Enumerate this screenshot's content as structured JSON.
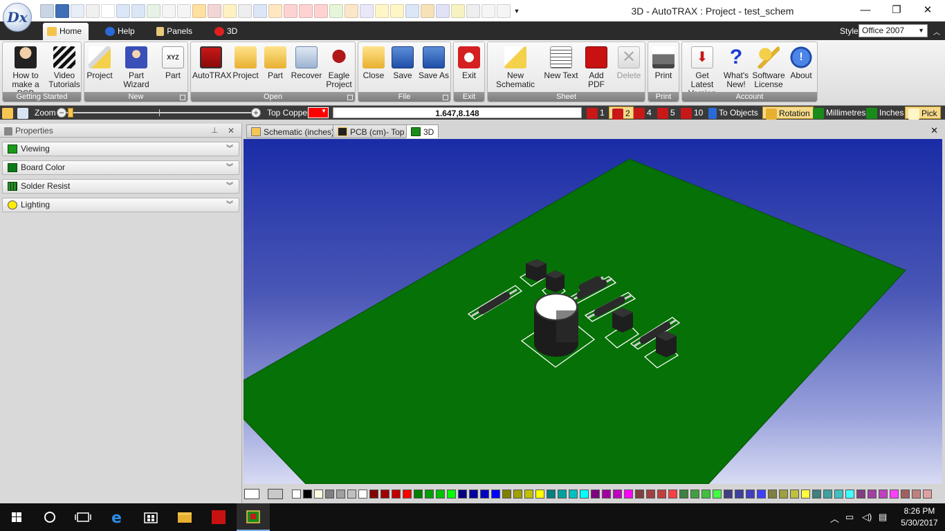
{
  "window": {
    "title": "3D - AutoTRAX : Project - test_schem",
    "logo_text": "Dx",
    "minimize": "—",
    "maximize": "❐",
    "close": "✕"
  },
  "menu_tabs": [
    {
      "label": "Home",
      "active": true
    },
    {
      "label": "Help"
    },
    {
      "label": "Panels"
    },
    {
      "label": "3D"
    }
  ],
  "style": {
    "label": "Style",
    "value": "Office 2007"
  },
  "ribbon": {
    "groups": [
      {
        "label": "Getting Started",
        "buttons": [
          {
            "label": "How to make a PCB"
          },
          {
            "label": "Video Tutorials"
          }
        ]
      },
      {
        "label": "New",
        "buttons": [
          {
            "label": "Project"
          },
          {
            "label": "Part Wizard"
          },
          {
            "label": "Part"
          }
        ]
      },
      {
        "label": "Open",
        "buttons": [
          {
            "label": "AutoTRAX"
          },
          {
            "label": "Project"
          },
          {
            "label": "Part"
          },
          {
            "label": "Recover"
          },
          {
            "label": "Eagle Project"
          }
        ]
      },
      {
        "label": "File",
        "buttons": [
          {
            "label": "Close"
          },
          {
            "label": "Save"
          },
          {
            "label": "Save As"
          }
        ]
      },
      {
        "label": "Exit",
        "buttons": [
          {
            "label": "Exit"
          }
        ]
      },
      {
        "label": "Sheet",
        "buttons": [
          {
            "label": "New Schematic"
          },
          {
            "label": "New Text"
          },
          {
            "label": "Add PDF"
          },
          {
            "label": "Delete"
          }
        ]
      },
      {
        "label": "Print",
        "buttons": [
          {
            "label": "Print"
          }
        ]
      },
      {
        "label": "Account",
        "buttons": [
          {
            "label": "Get Latest Version"
          },
          {
            "label": "What's New!"
          },
          {
            "label": "Software License"
          },
          {
            "label": "About"
          }
        ]
      }
    ]
  },
  "toolbar": {
    "zoom_label": "Zoom",
    "zoom_out": "−",
    "zoom_in": "+",
    "layer_label": "Top Copper",
    "coordinates": "1.647,8.148",
    "layer_buttons": [
      "1",
      "2",
      "4",
      "5",
      "10"
    ],
    "to_objects": "To Objects",
    "rotation": "Rotation",
    "millimetres": "Millimetres",
    "inches": "Inches",
    "pick": "Pick"
  },
  "properties": {
    "title": "Properties",
    "pin": "⊥",
    "close": "✕",
    "sections": [
      {
        "label": "Viewing",
        "color": "#1a9a1a"
      },
      {
        "label": "Board Color",
        "color": "#0c7a18"
      },
      {
        "label": "Solder Resist",
        "color": "#2e8b2e"
      },
      {
        "label": "Lighting",
        "color": "#ffee00"
      }
    ]
  },
  "doc_tabs": [
    {
      "label": "Schematic (inches)"
    },
    {
      "label": "PCB (cm)- Top"
    },
    {
      "label": "3D",
      "active": true
    }
  ],
  "doc_close": "✕",
  "viewport": {
    "background_top": "#1a2ca6",
    "board_color": "#067106",
    "silkscreen_color": "#ffffff"
  },
  "palette": {
    "colors": [
      "#ffffff",
      "#000000",
      "#ffffe0",
      "#808080",
      "#a0a0a0",
      "#c0c0c0",
      "#ffffff",
      "#800000",
      "#a00000",
      "#c00000",
      "#ff0000",
      "#008000",
      "#00a000",
      "#00c000",
      "#00ff00",
      "#000080",
      "#0000a0",
      "#0000c0",
      "#0000ff",
      "#808000",
      "#a0a000",
      "#c0c000",
      "#ffff00",
      "#008080",
      "#00a0a0",
      "#00c0c0",
      "#00ffff",
      "#800080",
      "#a000a0",
      "#c000c0",
      "#ff00ff",
      "#804040",
      "#a04040",
      "#c04040",
      "#ff4040",
      "#408040",
      "#40a040",
      "#40c040",
      "#40ff40",
      "#404080",
      "#4040a0",
      "#4040c0",
      "#4040ff",
      "#808040",
      "#a0a040",
      "#c0c040",
      "#ffff40",
      "#408080",
      "#40a0a0",
      "#40c0c0",
      "#40ffff",
      "#804080",
      "#a040a0",
      "#c040c0",
      "#ff40ff",
      "#a06060",
      "#c08080",
      "#e0a0a0"
    ]
  },
  "taskbar": {
    "time": "8:26 PM",
    "date": "5/30/2017"
  }
}
